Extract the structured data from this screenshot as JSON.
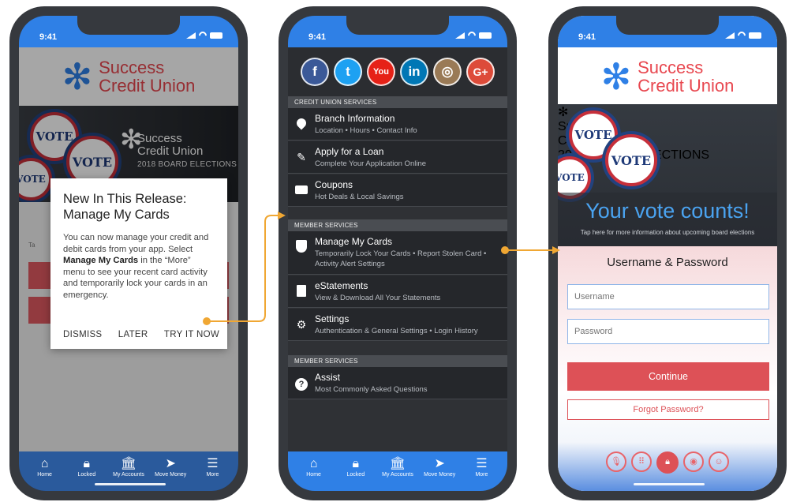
{
  "status": {
    "time": "9:41"
  },
  "logo": {
    "line1": "Success",
    "line2": "Credit Union"
  },
  "banner": {
    "line1": "Success",
    "line2": "Credit Union",
    "line3": "2018 BOARD ELECTIONS",
    "badge_text": "VOTE"
  },
  "dialog": {
    "title": "New In This Release: Manage My Cards",
    "body_pre": "You can now manage your credit and debit cards from your app. Select ",
    "body_bold": "Manage My Cards",
    "body_post": " in the “More” menu to see your recent card activity and temporarily lock your cards in an emergency.",
    "dismiss": "DISMISS",
    "later": "LATER",
    "try": "TRY IT NOW"
  },
  "phone1_partial_text": "Ta",
  "phone1_partial_text_right": "ns",
  "tabs_p1": [
    "Home",
    "Locked",
    "My Accounts",
    "Move Money",
    "More"
  ],
  "tabs_p2": [
    "Home",
    "Locked",
    "My Accounts",
    "Move Money",
    "More"
  ],
  "tab_icons": [
    "home-icon",
    "lock-icon",
    "bank-icon",
    "send-icon",
    "menu-icon"
  ],
  "social": [
    {
      "label": "f",
      "icon": "facebook-icon",
      "color": "#3b5998"
    },
    {
      "label": "t",
      "icon": "twitter-icon",
      "color": "#1da1f2"
    },
    {
      "label": "You",
      "icon": "youtube-icon",
      "color": "#e62117"
    },
    {
      "label": "in",
      "icon": "linkedin-icon",
      "color": "#0077b5"
    },
    {
      "label": "◎",
      "icon": "instagram-icon",
      "color": "#9a7a56"
    },
    {
      "label": "G+",
      "icon": "googleplus-icon",
      "color": "#dd4b39"
    }
  ],
  "menu": {
    "sec1": "CREDIT UNION SERVICES",
    "branch": {
      "title": "Branch Information",
      "sub": "Location • Hours • Contact Info"
    },
    "loan": {
      "title": "Apply for a Loan",
      "sub": "Complete Your Application Online"
    },
    "coupons": {
      "title": "Coupons",
      "sub": "Hot Deals & Local Savings"
    },
    "sec2": "MEMBER SERVICES",
    "cards": {
      "title": "Manage My Cards",
      "sub": "Temporarily Lock Your Cards • Report Stolen Card • Activity Alert Settings"
    },
    "estatements": {
      "title": "eStatements",
      "sub": "View & Download All Your Statements"
    },
    "settings": {
      "title": "Settings",
      "sub": "Authentication & General Settings • Login History"
    },
    "sec3": "MEMBER SERVICES",
    "assist": {
      "title": "Assist",
      "sub": "Most Commonly Asked Questions"
    }
  },
  "login": {
    "vote": "Your vote counts!",
    "tap": "Tap here for more information about upcoming board elections",
    "heading": "Username & Password",
    "username_placeholder": "Username",
    "password_placeholder": "Password",
    "continue": "Continue",
    "forgot": "Forgot Password?"
  },
  "auth_icons": [
    "microphone-icon",
    "keypad-icon",
    "lock-icon",
    "fingerprint-icon",
    "face-icon"
  ],
  "colors": {
    "brand_blue": "#2f80e6",
    "brand_red": "#e8474f",
    "connector": "#f0a733"
  }
}
